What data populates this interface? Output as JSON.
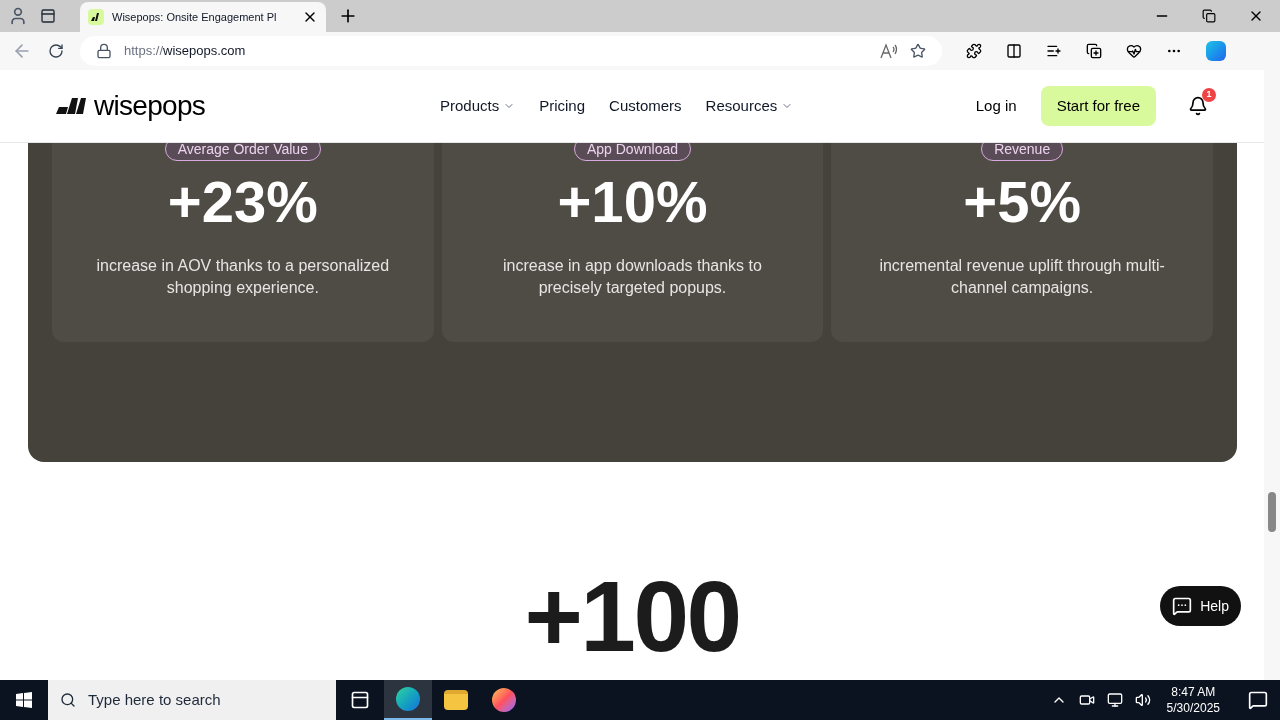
{
  "browser": {
    "tab_title": "Wisepops: Onsite Engagement Pl",
    "url_scheme": "https://",
    "url_host": "wisepops.com"
  },
  "site_nav": {
    "logo": "wisepops",
    "links": [
      {
        "label": "Products",
        "dropdown": true
      },
      {
        "label": "Pricing",
        "dropdown": false
      },
      {
        "label": "Customers",
        "dropdown": false
      },
      {
        "label": "Resources",
        "dropdown": true
      }
    ],
    "login": "Log in",
    "cta": "Start for free",
    "notification_count": "1"
  },
  "stats": [
    {
      "badge": "Average Order Value",
      "value": "+23%",
      "text": "increase in AOV thanks to a personalized shopping experience."
    },
    {
      "badge": "App Download",
      "value": "+10%",
      "text": "increase in app downloads thanks to precisely targeted popups."
    },
    {
      "badge": "Revenue",
      "value": "+5%",
      "text": "incremental revenue uplift through multi-channel campaigns."
    }
  ],
  "big_number": "+100",
  "help_button": "Help",
  "taskbar": {
    "search_placeholder": "Type here to search",
    "time": "8:47 AM",
    "date": "5/30/2025"
  }
}
